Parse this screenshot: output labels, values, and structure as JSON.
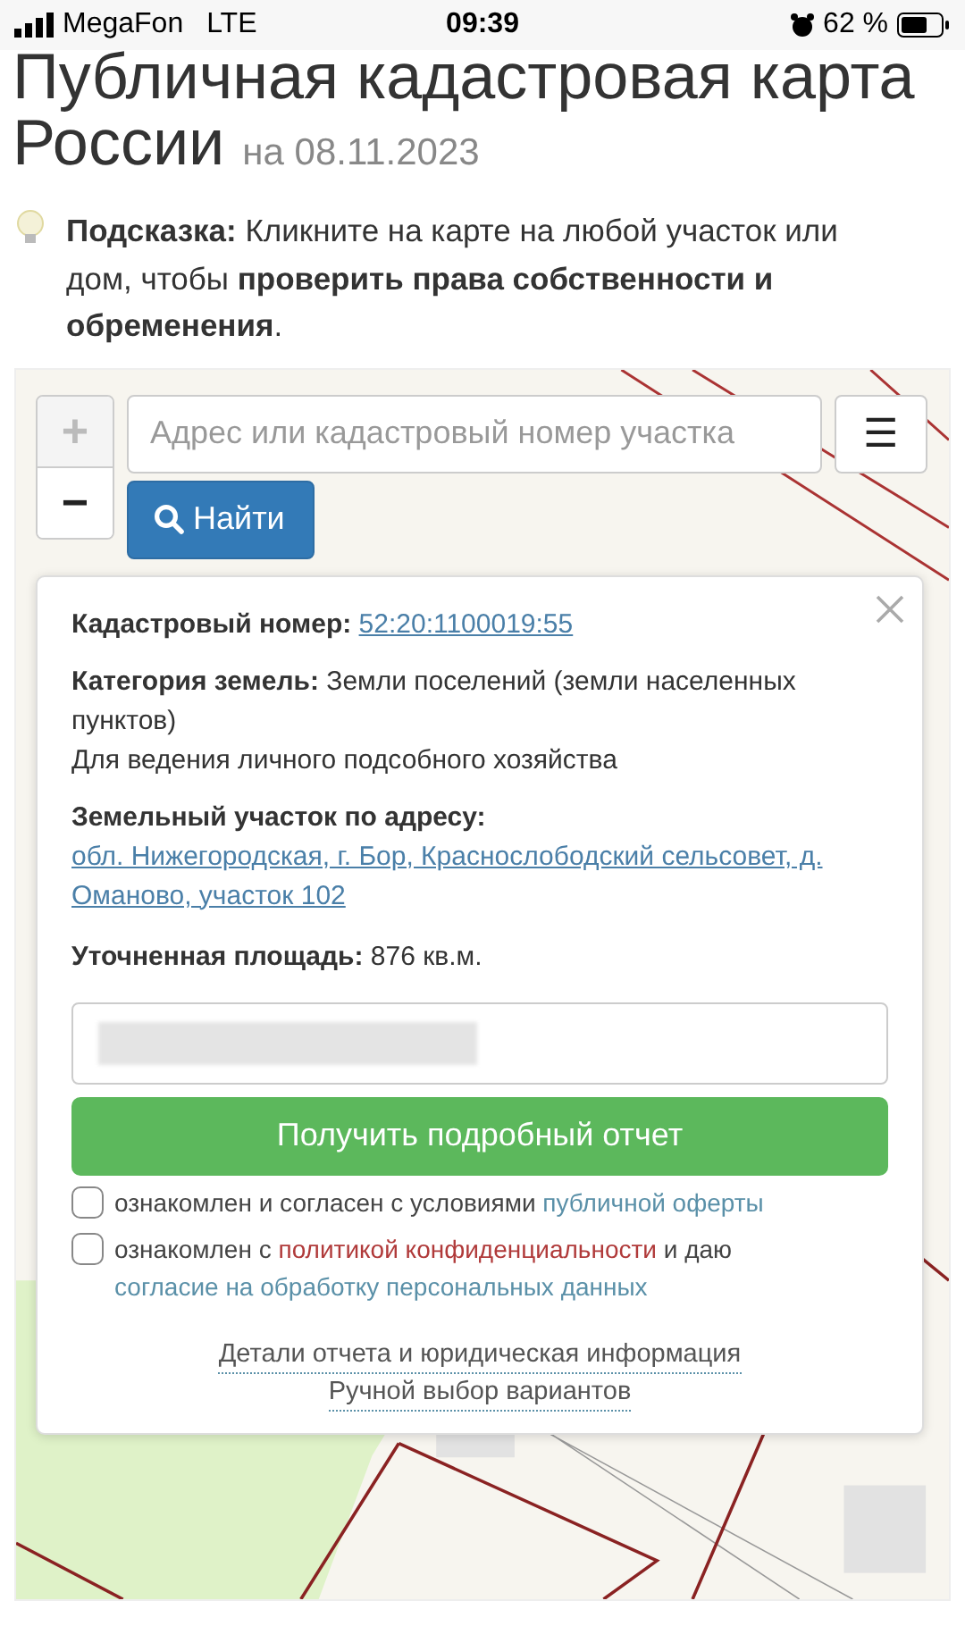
{
  "status_bar": {
    "carrier": "MegaFon",
    "network": "LTE",
    "time": "09:39",
    "battery": "62 %"
  },
  "header": {
    "title": "Публичная кадастровая карта России",
    "date": "на 08.11.2023"
  },
  "hint": {
    "text": "**Подсказка:** Кликните на карте на любой участок или дом, чтобы **проверить права собственности и обременения**."
  },
  "map": {
    "zoom_in": "+",
    "zoom_out": "−",
    "search": {
      "placeholder": "Адрес или кадастровый номер участка"
    },
    "menu": "☰",
    "find_button": "Найти"
  },
  "popup": {
    "fields": [
      {
        "kind": "link",
        "text": "**Кадастровый номер:**",
        "link": "52:20:1100019:55"
      },
      {
        "kind": "text",
        "text": "**Категория земель:** Земли поселений (земли населенных пунктов)"
      },
      {
        "kind": "note",
        "text": "Для ведения личного подсобного хозяйства"
      },
      {
        "kind": "address",
        "label": "Земельный участок по адресу:",
        "link": "обл. Нижегородская, г. Бор, Краснослободский сельсовет, д. Оманово, участок 102"
      },
      {
        "kind": "text",
        "text": "**Уточненная площадь:** 876 кв.м."
      }
    ],
    "report_field": {
      "redacted": true
    },
    "report_button": "Получить подробный отчет",
    "consents": [
      {
        "checked": false,
        "parts": [
          {
            "kind": "plain",
            "text": "ознакомлен и согласен с условиями "
          },
          {
            "kind": "link",
            "text": "публичной оферты"
          }
        ]
      },
      {
        "checked": false,
        "parts": [
          {
            "kind": "plain",
            "text": "ознакомлен с "
          },
          {
            "kind": "policy",
            "text": "политикой конфиденциальности"
          },
          {
            "kind": "plain",
            "text": " и даю "
          },
          {
            "kind": "link",
            "text": "согласие на обработку персональных данных"
          }
        ]
      }
    ],
    "footer_links": [
      "Детали отчета и юридическая информация",
      "Ручной выбор вариантов"
    ]
  }
}
